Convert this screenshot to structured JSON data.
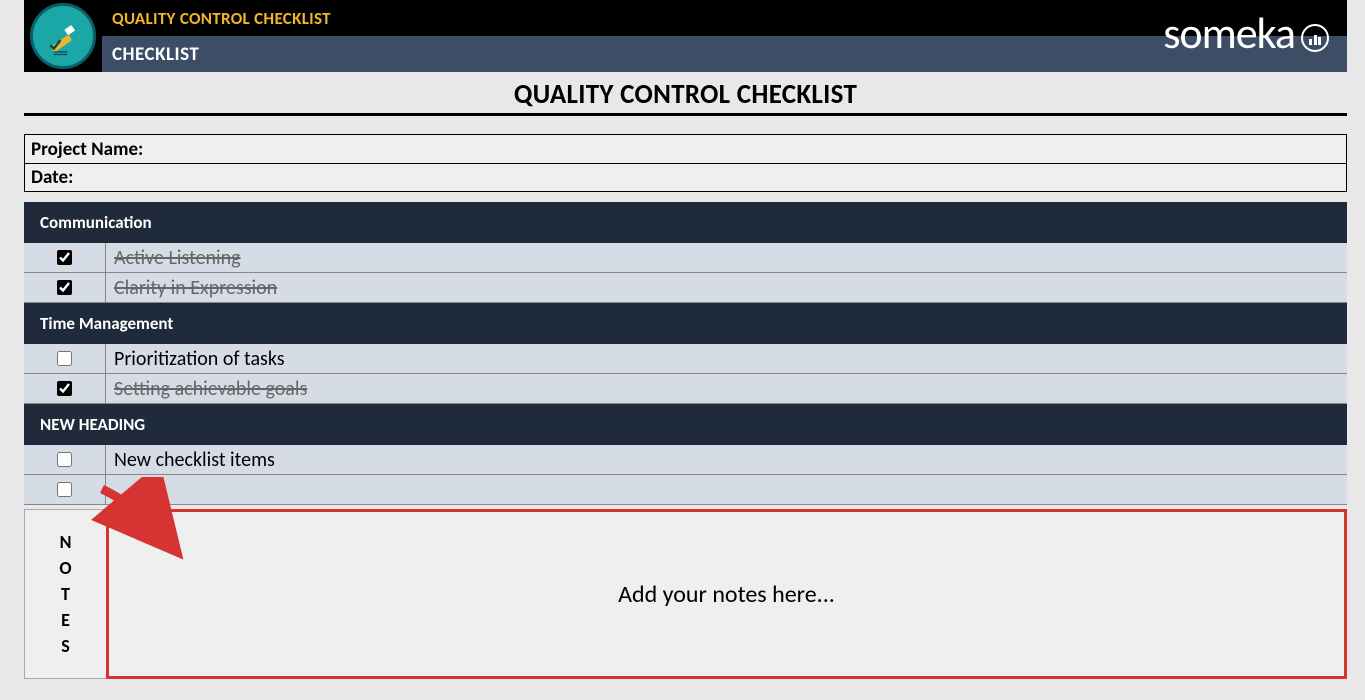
{
  "header": {
    "subtitle": "QUALITY CONTROL CHECKLIST",
    "section": "CHECKLIST",
    "brand": "someka"
  },
  "main_title": "QUALITY CONTROL CHECKLIST",
  "info": {
    "project_label": "Project Name:",
    "date_label": "Date:"
  },
  "sections": [
    {
      "heading": "Communication",
      "items": [
        {
          "label": "Active Listening",
          "checked": true
        },
        {
          "label": "Clarity in Expression",
          "checked": true
        }
      ]
    },
    {
      "heading": "Time Management",
      "items": [
        {
          "label": "Prioritization of tasks",
          "checked": false
        },
        {
          "label": "Setting achievable goals",
          "checked": true
        }
      ]
    },
    {
      "heading": "NEW HEADING",
      "items": [
        {
          "label": "New checklist items",
          "checked": false
        },
        {
          "label": "",
          "checked": false
        }
      ]
    }
  ],
  "notes": {
    "label_chars": [
      "N",
      "O",
      "T",
      "E",
      "S"
    ],
    "placeholder": "Add your notes here..."
  }
}
